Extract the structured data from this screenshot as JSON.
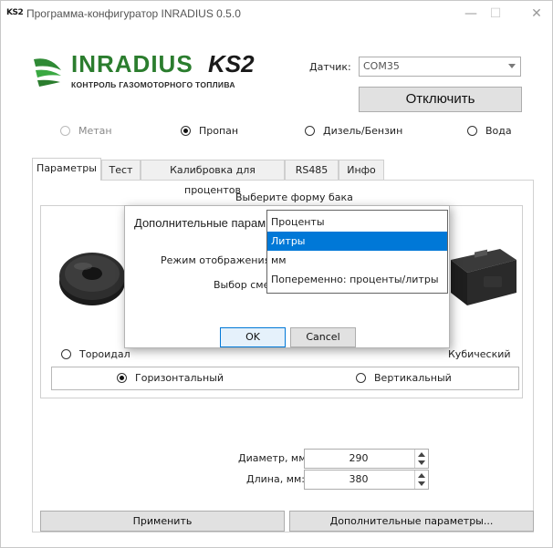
{
  "window": {
    "icon_text": "KS2",
    "title": "Программа-конфигуратор INRADIUS 0.5.0",
    "minimize": "—",
    "maximize": "☐",
    "close": "✕"
  },
  "logo": {
    "brand": "INRADIUS",
    "mark": "KS2",
    "tagline": "КОНТРОЛЬ ГАЗОМОТОРНОГО ТОПЛИВА"
  },
  "sensor": {
    "label": "Датчик:",
    "port": "COM35",
    "disconnect_label": "Отключить"
  },
  "fuel_types": [
    {
      "label": "Метан",
      "checked": false,
      "enabled": false
    },
    {
      "label": "Пропан",
      "checked": true,
      "enabled": true
    },
    {
      "label": "Дизель/Бензин",
      "checked": false,
      "enabled": true
    },
    {
      "label": "Вода",
      "checked": false,
      "enabled": true
    }
  ],
  "tabs": [
    {
      "label": "Параметры",
      "active": true
    },
    {
      "label": "Тест",
      "active": false
    },
    {
      "label": "Калибровка для процентов",
      "active": false
    },
    {
      "label": "RS485",
      "active": false
    },
    {
      "label": "Инфо",
      "active": false
    }
  ],
  "panel": {
    "shape_title": "Выберите форму бака",
    "shape_toroid": "Тороидал",
    "shape_cube": "Кубический",
    "orientation": [
      {
        "label": "Горизонтальный",
        "checked": true
      },
      {
        "label": "Вертикальный",
        "checked": false
      }
    ],
    "diameter_label": "Диаметр, мм",
    "diameter_value": "290",
    "length_label": "Длина, мм:",
    "length_value": "380",
    "apply_label": "Применить",
    "extra_label": "Дополнительные параметры..."
  },
  "dialog": {
    "title": "Дополнительные парам",
    "display_mode_label": "Режим отображения:",
    "offset_label": "Выбор смес",
    "ok_label": "OK",
    "cancel_label": "Cancel"
  },
  "dropdown": {
    "items": [
      {
        "label": "Проценты",
        "selected": false
      },
      {
        "label": "Литры",
        "selected": true
      },
      {
        "label": "мм",
        "selected": false
      },
      {
        "label": "Попеременно: проценты/литры",
        "selected": false
      }
    ]
  },
  "colors": {
    "accent": "#0078d7",
    "brand_green": "#2b7d2e"
  }
}
